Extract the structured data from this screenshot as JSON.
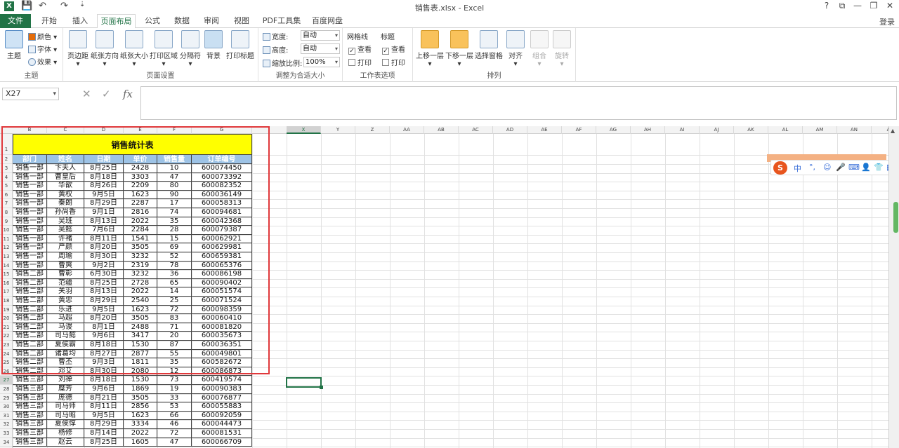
{
  "window": {
    "title": "销售表.xlsx - Excel",
    "app_logo": "X",
    "help": "?",
    "ribbon_display": "⧉",
    "minimize": "—",
    "restore": "❐",
    "close": "✕",
    "qa_save": "💾",
    "qa_undo": "↶",
    "qa_redo": "↷",
    "qa_more": "⇣"
  },
  "tabs": {
    "file": "文件",
    "items": [
      "开始",
      "插入",
      "页面布局",
      "公式",
      "数据",
      "审阅",
      "视图",
      "PDF工具集",
      "百度网盘"
    ],
    "active": "页面布局",
    "login": "登录"
  },
  "ribbon": {
    "theme_group": {
      "label": "主题",
      "theme": "主题",
      "colors": "颜色",
      "fonts": "字体",
      "effects": "效果"
    },
    "page_setup": {
      "label": "页面设置",
      "margins": "页边距",
      "orientation": "纸张方向",
      "size": "纸张大小",
      "print_area": "打印区域",
      "breaks": "分隔符",
      "background": "背景",
      "print_titles": "打印标题"
    },
    "scale_to_fit": {
      "label": "调整为合适大小",
      "width_label": "宽度:",
      "width_value": "自动",
      "height_label": "高度:",
      "height_value": "自动",
      "scale_label": "缩放比例:",
      "scale_value": "100%"
    },
    "sheet_options": {
      "label": "工作表选项",
      "gridlines": "网格线",
      "headings": "标题",
      "view": "查看",
      "print": "打印"
    },
    "arrange": {
      "label": "排列",
      "bring_forward": "上移一层",
      "send_backward": "下移一层",
      "selection_pane": "选择窗格",
      "align": "对齐",
      "group": "组合",
      "rotate": "旋转"
    }
  },
  "formula_bar": {
    "name_box": "X27",
    "cancel": "✕",
    "enter": "✓",
    "fx": "fx",
    "collapse": "⌃",
    "content": ""
  },
  "columns_left": [
    "B",
    "C",
    "D",
    "E",
    "F",
    "G"
  ],
  "columns_right": [
    "X",
    "Y",
    "Z",
    "AA",
    "AB",
    "AC",
    "AD",
    "AE",
    "AF",
    "AG",
    "AH",
    "AI",
    "AJ",
    "AK",
    "AL",
    "AM",
    "AN",
    "A"
  ],
  "sheet": {
    "title": "销售统计表",
    "headers": [
      "部门",
      "姓名",
      "日期",
      "单价",
      "销售量",
      "订单编号"
    ],
    "rows": [
      [
        "销售一部",
        "卞夫人",
        "8月25日",
        "2428",
        "10",
        "600074450"
      ],
      [
        "销售一部",
        "曹皇后",
        "8月18日",
        "3303",
        "47",
        "600073392"
      ],
      [
        "销售一部",
        "华歆",
        "8月26日",
        "2209",
        "80",
        "600082352"
      ],
      [
        "销售一部",
        "黄权",
        "9月5日",
        "1623",
        "90",
        "600036149"
      ],
      [
        "销售一部",
        "秦朗",
        "8月29日",
        "2287",
        "17",
        "600058313"
      ],
      [
        "销售一部",
        "孙尚香",
        "9月1日",
        "2816",
        "74",
        "600094681"
      ],
      [
        "销售一部",
        "吴班",
        "8月13日",
        "2022",
        "35",
        "600042368"
      ],
      [
        "销售一部",
        "吴懿",
        "7月6日",
        "2284",
        "28",
        "600079387"
      ],
      [
        "销售一部",
        "许褚",
        "8月11日",
        "1541",
        "15",
        "600062921"
      ],
      [
        "销售一部",
        "严颜",
        "8月20日",
        "3505",
        "69",
        "600629981"
      ],
      [
        "销售一部",
        "周瑜",
        "8月30日",
        "3232",
        "52",
        "600659381"
      ],
      [
        "销售一部",
        "曹爽",
        "9月2日",
        "2319",
        "78",
        "600065376"
      ],
      [
        "销售二部",
        "曹彰",
        "6月30日",
        "3232",
        "36",
        "600086198"
      ],
      [
        "销售二部",
        "范疆",
        "8月25日",
        "2728",
        "65",
        "600090402"
      ],
      [
        "销售二部",
        "关羽",
        "8月13日",
        "2022",
        "14",
        "600051574"
      ],
      [
        "销售二部",
        "黄忠",
        "8月29日",
        "2540",
        "25",
        "600071524"
      ],
      [
        "销售二部",
        "乐进",
        "9月5日",
        "1623",
        "72",
        "600098359"
      ],
      [
        "销售二部",
        "马超",
        "8月20日",
        "3505",
        "83",
        "600060410"
      ],
      [
        "销售二部",
        "马谡",
        "8月1日",
        "2488",
        "71",
        "600081820"
      ],
      [
        "销售二部",
        "司马懿",
        "9月6日",
        "3417",
        "20",
        "600035673"
      ],
      [
        "销售二部",
        "夏侯霸",
        "8月18日",
        "1530",
        "87",
        "600036351"
      ],
      [
        "销售二部",
        "诸葛均",
        "8月27日",
        "2877",
        "55",
        "600049801"
      ],
      [
        "销售二部",
        "曹丕",
        "9月3日",
        "1811",
        "35",
        "600582672"
      ],
      [
        "销售二部",
        "邓艾",
        "8月30日",
        "2080",
        "12",
        "600086873"
      ],
      [
        "销售三部",
        "刘禅",
        "8月18日",
        "1530",
        "73",
        "600419574"
      ],
      [
        "销售三部",
        "糜芳",
        "9月6日",
        "1869",
        "19",
        "600090383"
      ],
      [
        "销售三部",
        "庞德",
        "8月21日",
        "3505",
        "33",
        "600076877"
      ],
      [
        "销售三部",
        "司马师",
        "8月11日",
        "2856",
        "53",
        "600055883"
      ],
      [
        "销售三部",
        "司马昭",
        "9月5日",
        "1623",
        "66",
        "600092059"
      ],
      [
        "销售三部",
        "夏侯惇",
        "8月29日",
        "3334",
        "46",
        "600044473"
      ],
      [
        "销售三部",
        "杨修",
        "8月14日",
        "2022",
        "72",
        "600081531"
      ],
      [
        "销售三部",
        "赵云",
        "8月25日",
        "1605",
        "47",
        "600066709"
      ]
    ]
  },
  "ime": {
    "logo": "S",
    "items": [
      "中",
      "°,",
      "☺",
      "🎤",
      "⌨",
      "👤",
      "👕",
      "▦"
    ]
  },
  "scroll": {
    "up": "▲"
  }
}
